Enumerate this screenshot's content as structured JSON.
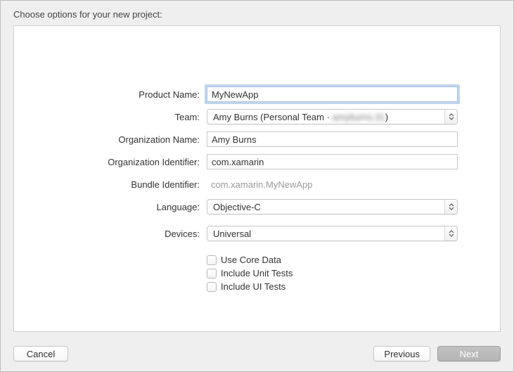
{
  "title": "Choose options for your new project:",
  "labels": {
    "product_name": "Product Name:",
    "team": "Team:",
    "org_name": "Organization Name:",
    "org_identifier": "Organization Identifier:",
    "bundle_identifier": "Bundle Identifier:",
    "language": "Language:",
    "devices": "Devices:"
  },
  "values": {
    "product_name": "MyNewApp",
    "team_prefix": "Amy Burns (Personal Team · ",
    "team_blur": "amyburns.31",
    "team_suffix": ")",
    "org_name": "Amy Burns",
    "org_identifier": "com.xamarin",
    "bundle_identifier": "com.xamarin.MyNewApp",
    "language": "Objective-C",
    "devices": "Universal"
  },
  "checkboxes": {
    "core_data": "Use Core Data",
    "unit_tests": "Include Unit Tests",
    "ui_tests": "Include UI Tests"
  },
  "buttons": {
    "cancel": "Cancel",
    "previous": "Previous",
    "next": "Next"
  }
}
